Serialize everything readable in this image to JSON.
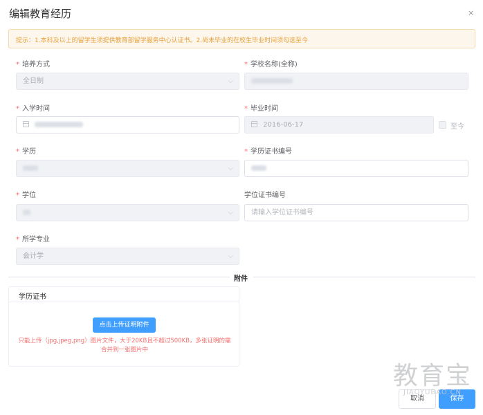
{
  "dialog": {
    "title": "编辑教育经历",
    "close_icon": "×"
  },
  "tip": {
    "text": "提示：1.本科及以上的留学生须提供教育部留学服务中心认证书。2.尚未毕业的在校生毕业时间须勾选至今"
  },
  "form": {
    "training_mode": {
      "label": "培养方式",
      "value": "全日制"
    },
    "school_name": {
      "label": "学校名称(全称)"
    },
    "enroll_date": {
      "label": "入学时间"
    },
    "grad_date": {
      "label": "毕业时间",
      "value": "2016-06-17"
    },
    "until_now": {
      "label": "至今"
    },
    "education": {
      "label": "学历"
    },
    "edu_cert_no": {
      "label": "学历证书编号"
    },
    "degree": {
      "label": "学位"
    },
    "degree_cert_no": {
      "label": "学位证书编号",
      "placeholder": "请输入学位证书编号"
    },
    "major": {
      "label": "所学专业",
      "value": "会计学"
    }
  },
  "attachments": {
    "divider": "附件",
    "card_title": "学历证书",
    "upload_button": "点击上传证明附件",
    "upload_tip": "只能上传（jpg,jpeg,png）图片文件，大于20KB且不超过500KB，多张证明的需合并到一张图片中"
  },
  "watermark": {
    "cn": "教育宝",
    "en": "JIAOYUBAO.CN"
  },
  "footer": {
    "cancel": "取消",
    "save": "保存"
  },
  "colors": {
    "primary": "#409eff",
    "required": "#f56c6c",
    "warning_bg": "#fdf6ec",
    "warning_text": "#e6a23c"
  }
}
